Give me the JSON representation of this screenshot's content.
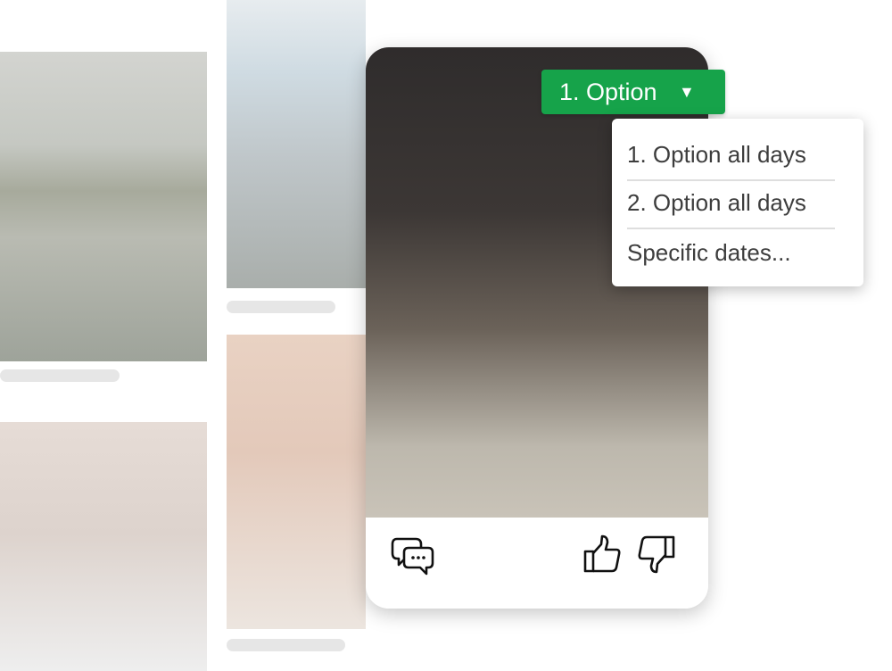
{
  "dropdown": {
    "selected": "1. Option",
    "caret_icon": "caret-down-icon",
    "color": "#16a34a",
    "options": [
      "1. Option all days",
      "2. Option all days",
      "Specific dates..."
    ]
  },
  "card": {
    "actions": {
      "comment_icon": "speech-bubbles-icon",
      "like_icon": "thumbs-up-icon",
      "dislike_icon": "thumbs-down-icon"
    }
  }
}
